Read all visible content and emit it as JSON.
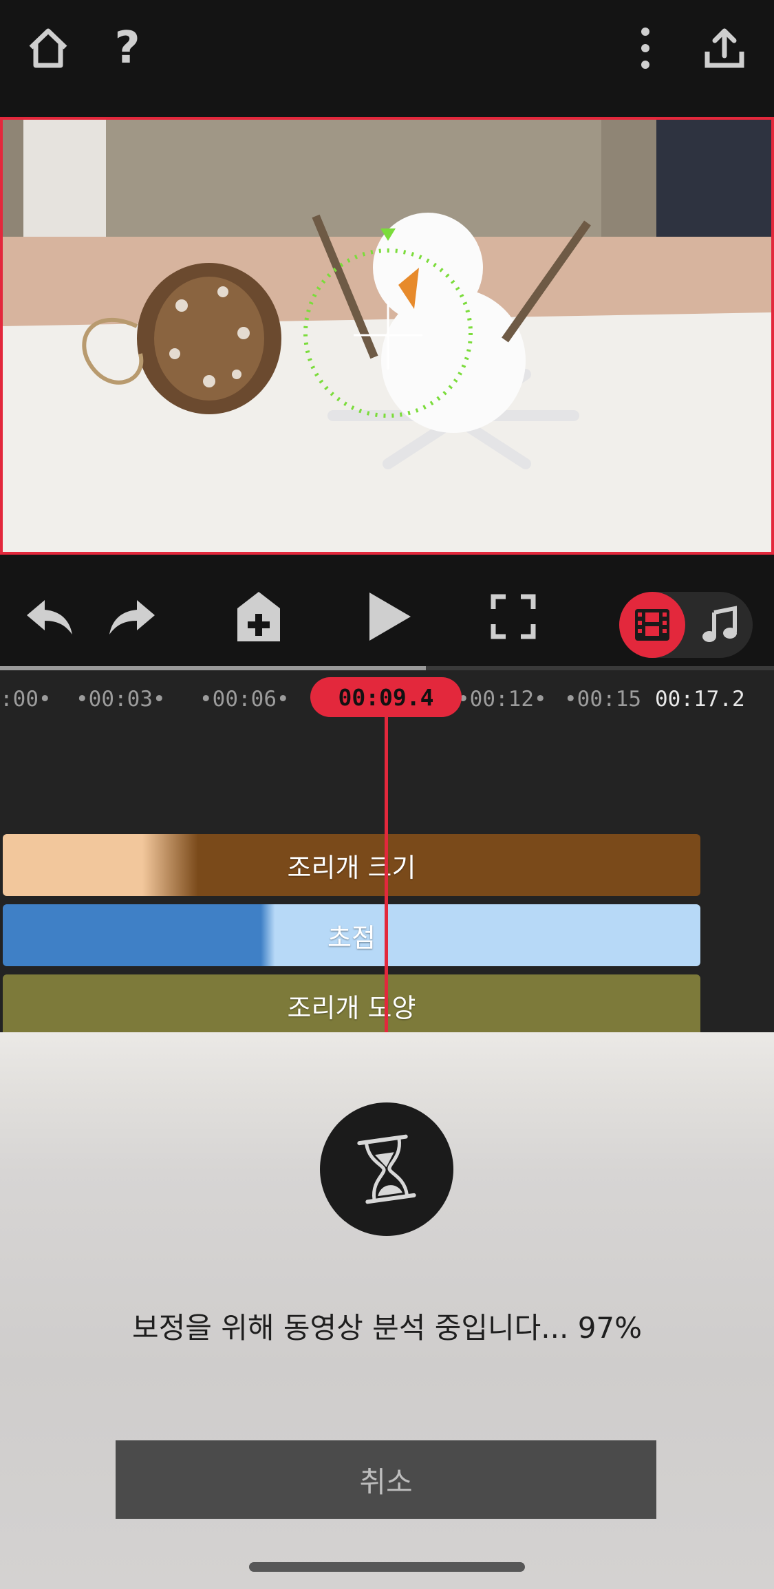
{
  "topbar": {
    "icons": [
      "home-icon",
      "help-icon",
      "more-icon",
      "share-icon"
    ],
    "help_glyph": "?"
  },
  "preview": {
    "border_color": "#e3283c",
    "focus_ring_color": "#7bdc3b"
  },
  "controls": {
    "icons": [
      "undo-icon",
      "redo-icon",
      "add-clip-icon",
      "play-icon",
      "fullscreen-icon",
      "video-track-icon",
      "audio-track-icon"
    ],
    "active_mode": "video"
  },
  "playback": {
    "progress": 0.55
  },
  "timeline": {
    "ticks": [
      ":00•",
      "•00:03•",
      "•00:06•",
      "•00:12•",
      "•00:15"
    ],
    "end_time": "00:17.2",
    "playhead_time": "00:09.4",
    "tracks": [
      {
        "label": "조리개 크기",
        "colors": [
          "#f2c79c",
          "#7a4a1a"
        ]
      },
      {
        "label": "초점",
        "colors": [
          "#3f80c6",
          "#b7d9f7"
        ]
      },
      {
        "label": "조리개 모양",
        "colors": [
          "#7d7a3a",
          "#7d7a3a"
        ]
      }
    ]
  },
  "dialog": {
    "icon": "hourglass-icon",
    "message": "보정을 위해 동영상 분석 중입니다... 97%",
    "cancel_label": "취소"
  }
}
